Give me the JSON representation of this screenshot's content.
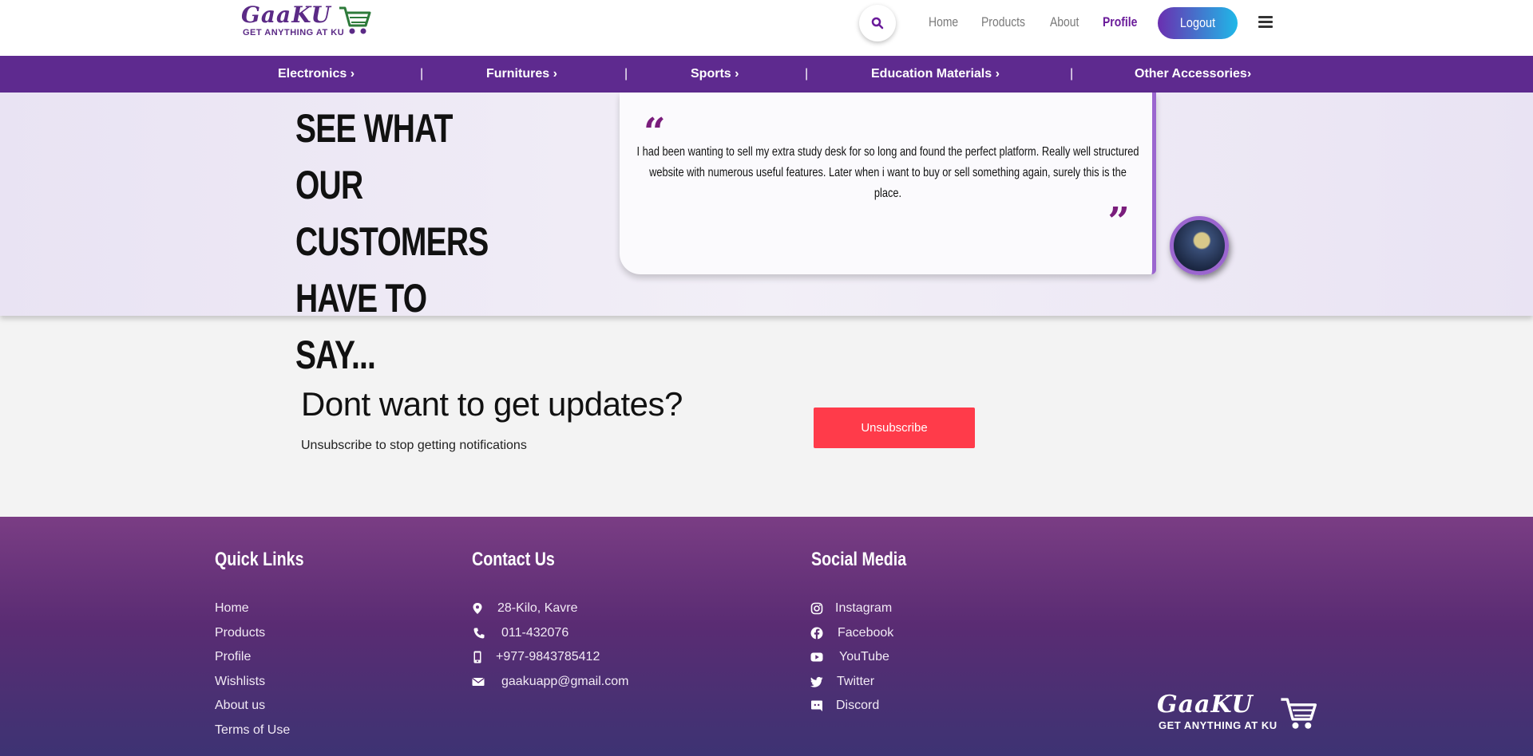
{
  "header": {
    "logo_text": "GaaKU",
    "logo_tagline": "GET ANYTHING AT KU",
    "nav": [
      {
        "label": "Home",
        "active": false
      },
      {
        "label": "Products",
        "active": false
      },
      {
        "label": "About",
        "active": false
      },
      {
        "label": "Profile",
        "active": true
      }
    ],
    "logout_label": "Logout"
  },
  "categories": [
    "Electronics ›",
    "Furnitures ›",
    "Sports ›",
    "Education Materials ›",
    "Other Accessories›"
  ],
  "testimonial": {
    "heading_lines": [
      "SEE WHAT OUR",
      "CUSTOMERS",
      "HAVE TO SAY..."
    ],
    "quote": "I had been wanting to sell my extra study desk for so long and found the perfect platform. Really well structured website with numerous useful features. Later when i want to buy or sell something again, surely this is the place."
  },
  "unsubscribe": {
    "title": "Dont want to get updates?",
    "subtitle": "Unsubscribe to stop getting notifications",
    "button_label": "Unsubscribe"
  },
  "footer": {
    "quick_links": {
      "title": "Quick Links",
      "items": [
        "Home",
        "Products",
        "Profile",
        "Wishlists",
        "About us",
        "Terms of Use"
      ]
    },
    "contact": {
      "title": "Contact Us",
      "items": [
        {
          "icon": "map-pin-icon",
          "text": "28-Kilo, Kavre"
        },
        {
          "icon": "phone-icon",
          "text": "011-432076"
        },
        {
          "icon": "mobile-icon",
          "text": "+977-9843785412"
        },
        {
          "icon": "envelope-icon",
          "text": "gaakuapp@gmail.com"
        }
      ]
    },
    "social": {
      "title": "Social Media",
      "items": [
        {
          "icon": "instagram-icon",
          "text": "Instagram"
        },
        {
          "icon": "facebook-icon",
          "text": "Facebook"
        },
        {
          "icon": "youtube-icon",
          "text": "YouTube"
        },
        {
          "icon": "twitter-icon",
          "text": "Twitter"
        },
        {
          "icon": "discord-icon",
          "text": "Discord"
        }
      ]
    },
    "logo_text": "GaaKU",
    "logo_tagline": "GET ANYTHING AT KU"
  },
  "colors": {
    "brand_purple": "#5e2a8f",
    "accent_quote": "#7a1d7c",
    "unsubscribe_red": "#ff3b4a",
    "logout_gradient_start": "#6a2fb0",
    "logout_gradient_end": "#1fb8e8"
  }
}
